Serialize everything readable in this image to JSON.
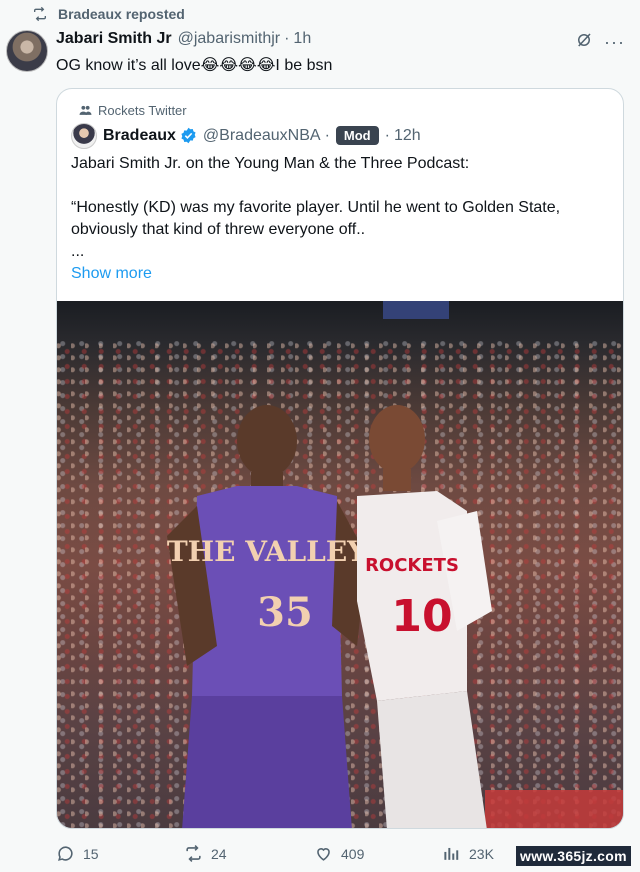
{
  "repost": {
    "label": "Bradeaux reposted"
  },
  "tweet": {
    "author_name": "Jabari Smith Jr",
    "author_handle": "@jabarismithjr",
    "separator": "·",
    "time": "1h",
    "text": "OG know it’s all love😂😂😂😂I be bsn"
  },
  "quote": {
    "community": "Rockets Twitter",
    "author_name": "Bradeaux",
    "author_handle": "@BradeauxNBA",
    "separator": "·",
    "badge": "Mod",
    "separator2": "·",
    "time": "12h",
    "line1": "Jabari Smith Jr. on the Young Man & the Three Podcast:",
    "line2": "“Honestly (KD) was my favorite player. Until he went to Golden State,",
    "line3": "obviously that kind of threw everyone off..",
    "line4": "...",
    "show_more": "Show more",
    "image": {
      "jersey_left_text": "THE VALLEY",
      "jersey_left_number": "35",
      "jersey_right_text": "ROCKETS",
      "jersey_right_number": "10"
    }
  },
  "actions": {
    "replies": "15",
    "reposts": "24",
    "likes": "409",
    "views": "23K"
  },
  "watermark": "www.365jz.com",
  "icons": {
    "repost": "repost-icon",
    "grok": "grok-icon",
    "more": "more-icon",
    "community": "people-icon",
    "verified": "verified-icon",
    "reply": "reply-icon",
    "like": "heart-icon",
    "views": "views-icon"
  },
  "colors": {
    "link": "#1d9bf0",
    "secondary_text": "#536471",
    "badge_bg": "#3a4450"
  }
}
